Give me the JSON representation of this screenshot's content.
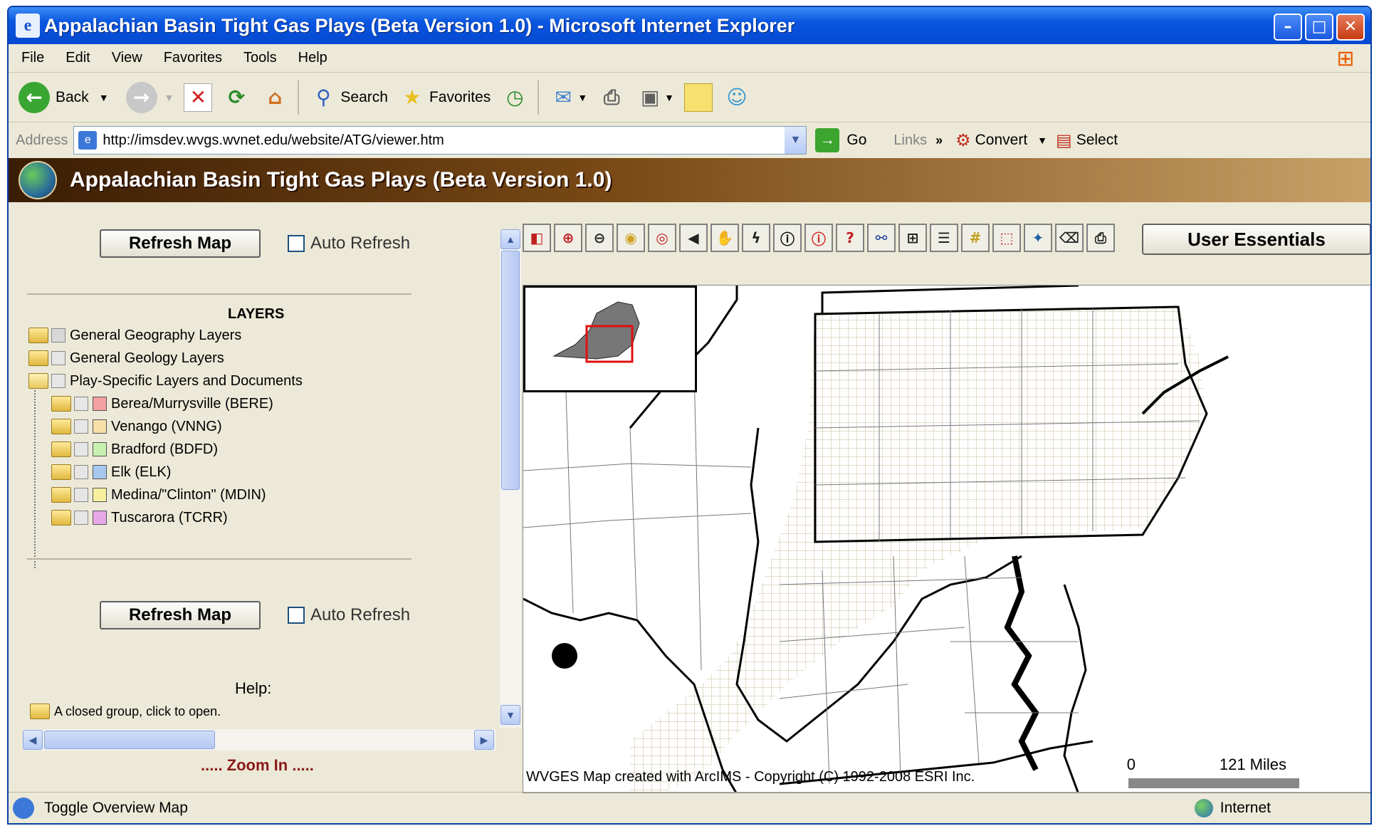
{
  "window": {
    "title": "Appalachian Basin Tight Gas Plays (Beta Version 1.0) - Microsoft Internet Explorer"
  },
  "menu": [
    "File",
    "Edit",
    "View",
    "Favorites",
    "Tools",
    "Help"
  ],
  "toolbar": {
    "back": "Back",
    "search": "Search",
    "favorites": "Favorites"
  },
  "address": {
    "label": "Address",
    "url": "http://imsdev.wvgs.wvnet.edu/website/ATG/viewer.htm",
    "go": "Go",
    "links": "Links",
    "convert": "Convert",
    "select": "Select"
  },
  "app": {
    "title": "Appalachian Basin Tight Gas Plays (Beta Version 1.0)"
  },
  "left": {
    "refresh_label": "Refresh Map",
    "auto_refresh_label": "Auto Refresh",
    "layers_heading": "LAYERS",
    "layers": [
      {
        "label": "General Geography Layers"
      },
      {
        "label": "General Geology Layers"
      },
      {
        "label": "Play-Specific Layers and Documents"
      }
    ],
    "plays": [
      {
        "label": "Berea/Murrysville (BERE)",
        "color": "#f4a0a0"
      },
      {
        "label": "Venango (VNNG)",
        "color": "#f6e0a8"
      },
      {
        "label": "Bradford (BDFD)",
        "color": "#c8f0b0"
      },
      {
        "label": "Elk (ELK)",
        "color": "#a8c8f0"
      },
      {
        "label": "Medina/\"Clinton\" (MDIN)",
        "color": "#f8f0a0"
      },
      {
        "label": "Tuscarora (TCRR)",
        "color": "#e8a8e8"
      }
    ],
    "help_label": "Help:",
    "help_text": "A closed group, click to open.",
    "zoom_label": "..... Zoom In ....."
  },
  "map": {
    "user_essentials": "User Essentials",
    "copyright": "WVGES Map created with ArcIMS - Copyright (C) 1992-2008 ESRI Inc.",
    "scale_start": "0",
    "scale_end": "121 Miles"
  },
  "status": {
    "text": "Toggle Overview Map",
    "zone": "Internet"
  }
}
